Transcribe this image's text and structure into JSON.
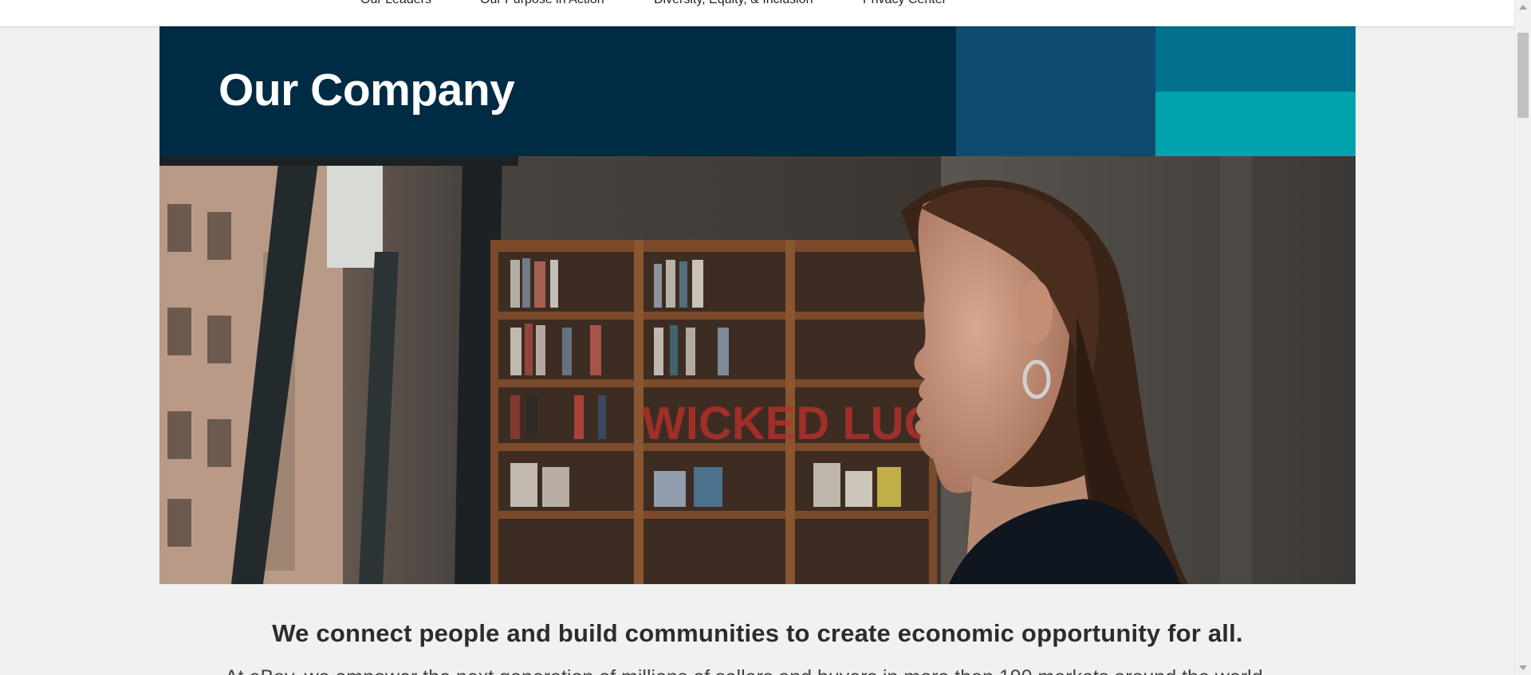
{
  "nav": {
    "items": [
      {
        "label": "Our Leaders"
      },
      {
        "label": "Our Purpose in Action"
      },
      {
        "label": "Diversity, Equity, & Inclusion"
      },
      {
        "label": "Privacy Center"
      }
    ]
  },
  "hero": {
    "title": "Our Company",
    "colors": {
      "background": "#002b45",
      "block_dark_blue": "#0f4a71",
      "block_teal": "#00708f",
      "block_aqua": "#00a3ad"
    }
  },
  "photo": {
    "sign_text": "WICKED LUCK"
  },
  "content": {
    "headline": "We connect people and build communities to create economic opportunity for all.",
    "body_partial": "At eBay, we empower the next generation of millions of sellers and buyers in more than 190 markets around the world"
  }
}
